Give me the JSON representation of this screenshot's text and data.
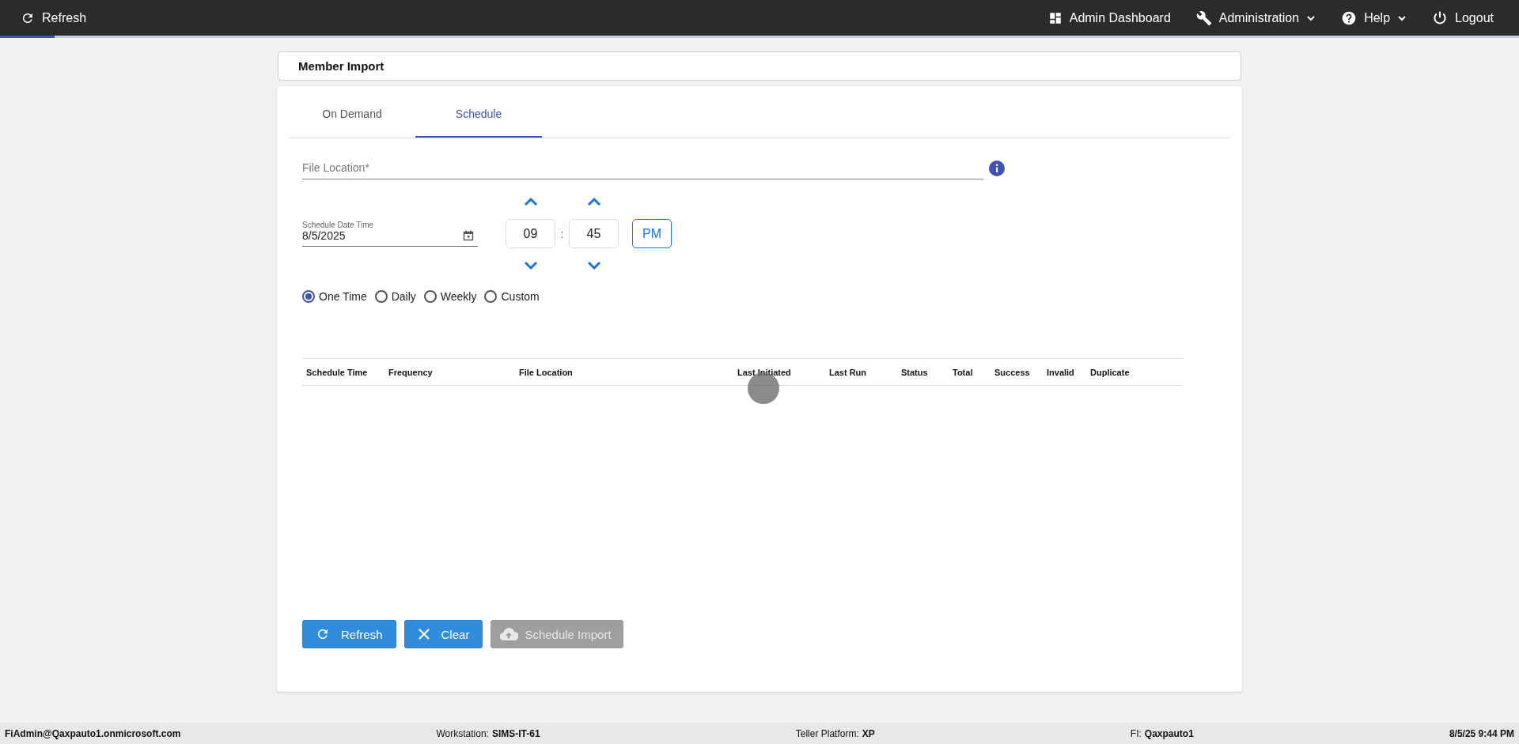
{
  "top_bar": {
    "refresh": "Refresh",
    "items": [
      {
        "kind": "dashboard",
        "label": "Admin Dashboard",
        "dropdown": false
      },
      {
        "kind": "wrench",
        "label": "Administration",
        "dropdown": true
      },
      {
        "kind": "help",
        "label": "Help",
        "dropdown": true
      },
      {
        "kind": "power",
        "label": "Logout",
        "dropdown": false
      }
    ],
    "progress": {
      "level": 0.036
    }
  },
  "page_title": "Member Import",
  "tabs": [
    {
      "label": "On Demand",
      "selected": false
    },
    {
      "label": "Schedule",
      "selected": true
    }
  ],
  "file_location": {
    "placeholder": "File Location*"
  },
  "schedule_date": {
    "label": "Schedule Date Time",
    "value": "8/5/2025"
  },
  "time": {
    "hour": "09",
    "separator": ":",
    "minute": "45",
    "period": "PM"
  },
  "frequency": [
    {
      "label": "One Time",
      "selected": true
    },
    {
      "label": "Daily",
      "selected": false
    },
    {
      "label": "Weekly",
      "selected": false
    },
    {
      "label": "Custom",
      "selected": false
    }
  ],
  "table": {
    "columns": [
      "Schedule Time",
      "Frequency",
      "File Location",
      "Last Initiated",
      "Last Run",
      "Status",
      "Total",
      "Success",
      "Invalid",
      "Duplicate"
    ]
  },
  "buttons": [
    {
      "kind": "refresh",
      "label": "Refresh",
      "disabled": false
    },
    {
      "kind": "clear",
      "label": "Clear",
      "disabled": false
    },
    {
      "kind": "upload",
      "label": "Schedule Import",
      "disabled": true
    }
  ],
  "status_bar": [
    {
      "value": "FiAdmin@Qaxpauto1.onmicrosoft.com"
    },
    {
      "label": "Workstation:",
      "value": "SIMS-IT-61"
    },
    {
      "label": "Teller Platform:",
      "value": "XP"
    },
    {
      "label": "FI:",
      "value": "Qaxpauto1"
    },
    {
      "value": "8/5/25 9:44 PM"
    }
  ]
}
